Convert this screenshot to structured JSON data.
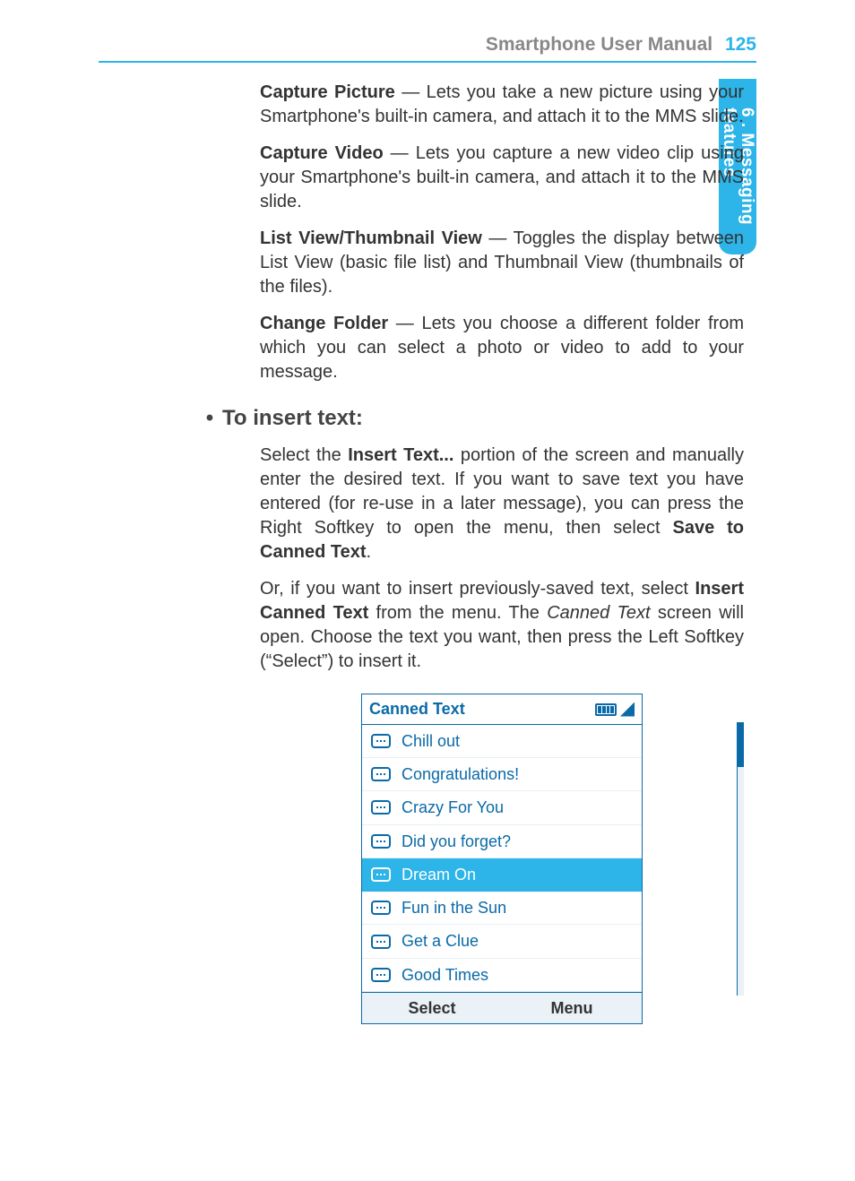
{
  "header": {
    "title": "Smartphone User Manual",
    "page": "125"
  },
  "side_tab": {
    "ch": "6 . Messaging",
    "sub": "features"
  },
  "options": [
    {
      "term": "Capture Picture",
      "sep": " — ",
      "desc": "Lets you take a new picture using your Smartphone's built-in camera, and attach it to the MMS slide."
    },
    {
      "term": "Capture Video",
      "sep": " — ",
      "desc": "Lets you capture a new video clip using your Smartphone's built-in camera, and attach it to the MMS slide."
    },
    {
      "term": "List View/Thumbnail View",
      "sep": " — ",
      "desc": "Toggles the display between List View (basic file list) and Thumbnail View (thumbnails of the files)."
    },
    {
      "term": "Change Folder",
      "sep": " — ",
      "desc": "Lets you choose a different folder from which you can select a photo or video to add to your message."
    }
  ],
  "section": {
    "bullet": "•",
    "heading": "To insert text:",
    "p1_a": "Select the ",
    "p1_b1": "Insert Text...",
    "p1_c": " portion of the screen and manually enter the desired text.  If you want to save text you have entered (for re-use in a later message), you can press the Right Softkey to open the menu, then select ",
    "p1_b2": "Save to Canned Text",
    "p1_d": ".",
    "p2_a": "Or, if you want to insert previously-saved text, select ",
    "p2_b1": "Insert Canned Text",
    "p2_c": " from the menu.  The ",
    "p2_i1": "Canned Text",
    "p2_d": " screen will open.  Choose the text you want, then press the Left Softkey (“Select”) to insert it."
  },
  "phone": {
    "title": "Canned Text",
    "items": [
      {
        "label": "Chill out",
        "selected": false
      },
      {
        "label": "Congratulations!",
        "selected": false
      },
      {
        "label": "Crazy For You",
        "selected": false
      },
      {
        "label": "Did you forget?",
        "selected": false
      },
      {
        "label": "Dream On",
        "selected": true
      },
      {
        "label": "Fun in the Sun",
        "selected": false
      },
      {
        "label": "Get a Clue",
        "selected": false
      },
      {
        "label": "Good Times",
        "selected": false
      }
    ],
    "softkeys": {
      "left": "Select",
      "right": "Menu"
    }
  }
}
